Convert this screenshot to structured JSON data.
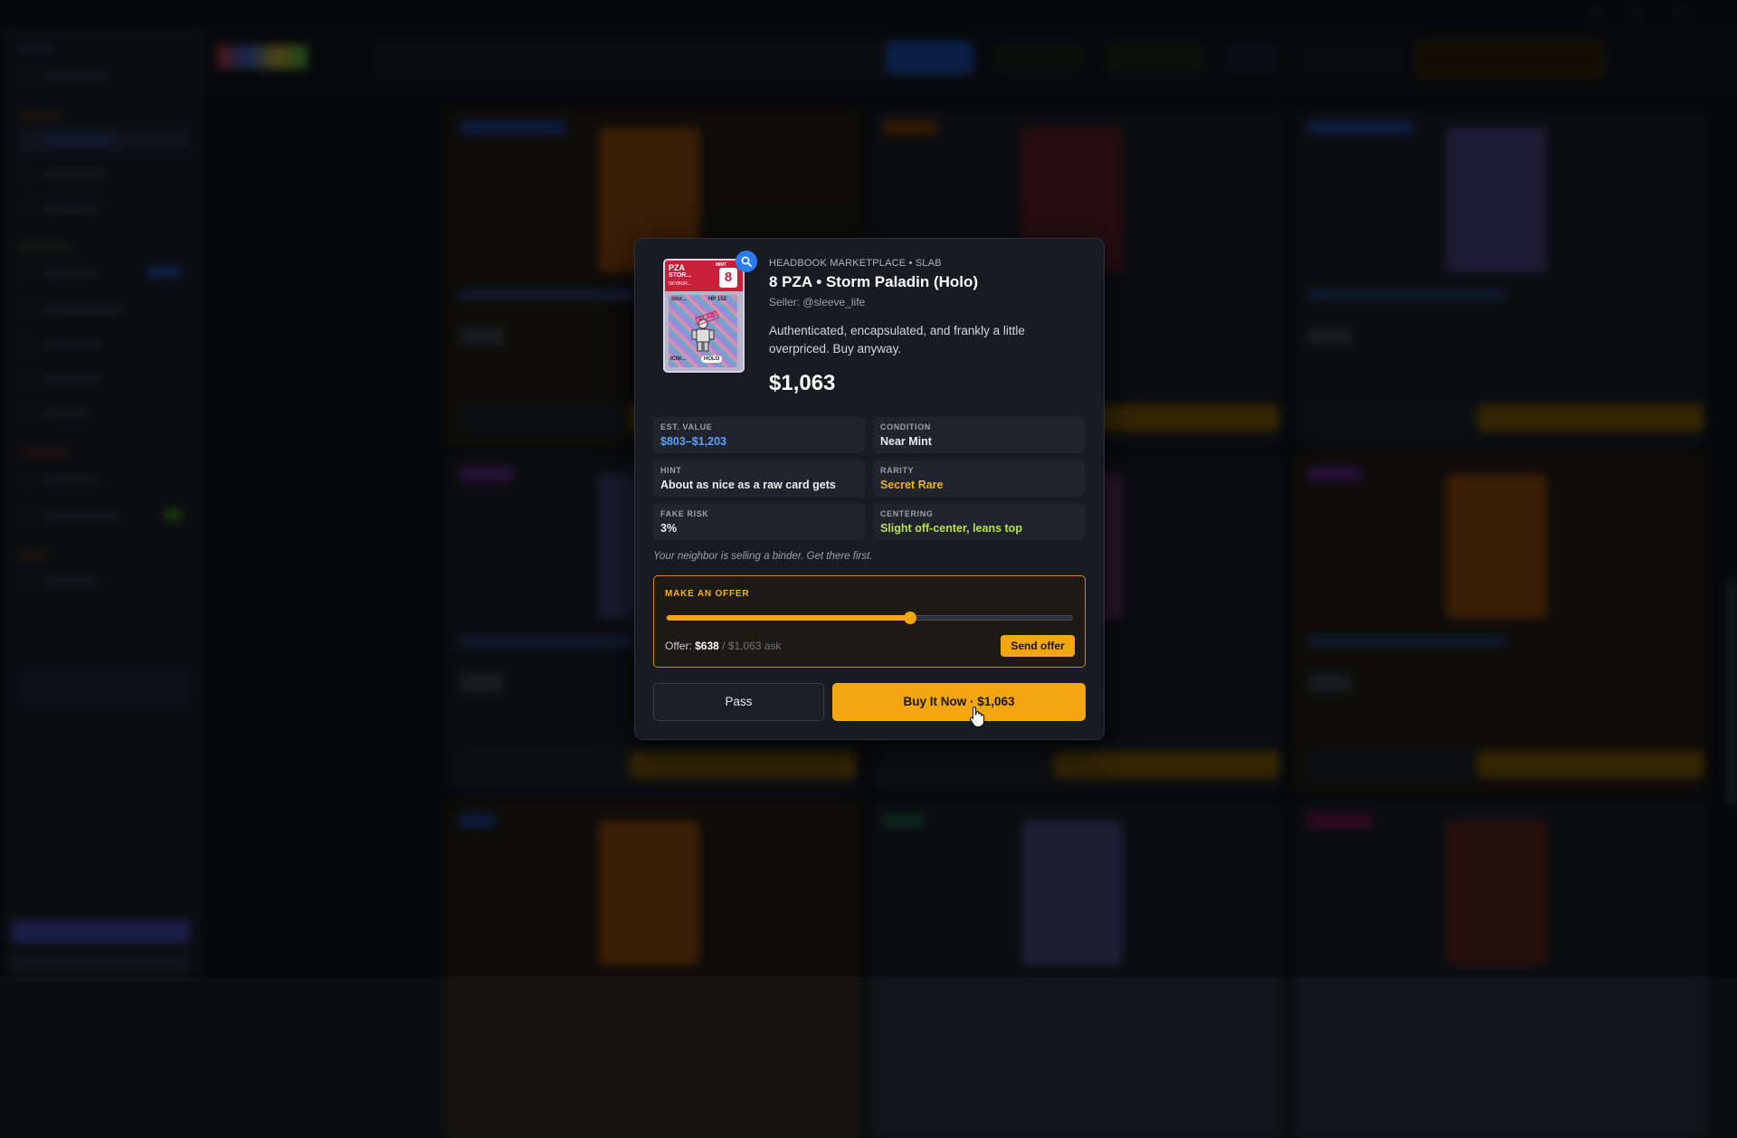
{
  "modal": {
    "eyebrow": "HEADBOOK MARKETPLACE • SLAB",
    "title": "8 PZA • Storm Paladin (Holo)",
    "seller": "Seller: @sleeve_life",
    "description": "Authenticated, encapsulated, and frankly a little overpriced. Buy anyway.",
    "price": "$1,063",
    "card": {
      "grader": "PZA",
      "grade": "8",
      "gem_label": "MINT",
      "name_short": "STOR...",
      "set_short": "SKYBOR...",
      "inner_name": "Stor...",
      "hp": "HP 152",
      "stamp": "SLAB",
      "foil": "HOLO",
      "number": "ICNI..."
    },
    "stats": [
      {
        "label": "EST. VALUE",
        "value": "$803–$1,203",
        "color": "#5aa0ff"
      },
      {
        "label": "CONDITION",
        "value": "Near Mint",
        "color": "#e8eaed"
      },
      {
        "label": "HINT",
        "value": "About as nice as a raw card gets",
        "color": "#e8eaed"
      },
      {
        "label": "RARITY",
        "value": "Secret Rare",
        "color": "#f2b01d"
      },
      {
        "label": "FAKE RISK",
        "value": "3%",
        "color": "#e8eaed"
      },
      {
        "label": "CENTERING",
        "value": "Slight off-center, leans top",
        "color": "#b8e04a"
      }
    ],
    "tip": "Your neighbor is selling a binder. Get there first.",
    "offer": {
      "label": "MAKE AN OFFER",
      "prefix": "Offer: ",
      "amount": "$638",
      "ask": "/ $1,063 ask",
      "slider_fraction": 0.6,
      "send_label": "Send offer"
    },
    "pass_label": "Pass",
    "buy_label": "Buy It Now · $1,063"
  },
  "colors": {
    "accent": "#f2a60f",
    "primary_blue": "#2b7bf0",
    "modal_bg": "#181b22"
  }
}
